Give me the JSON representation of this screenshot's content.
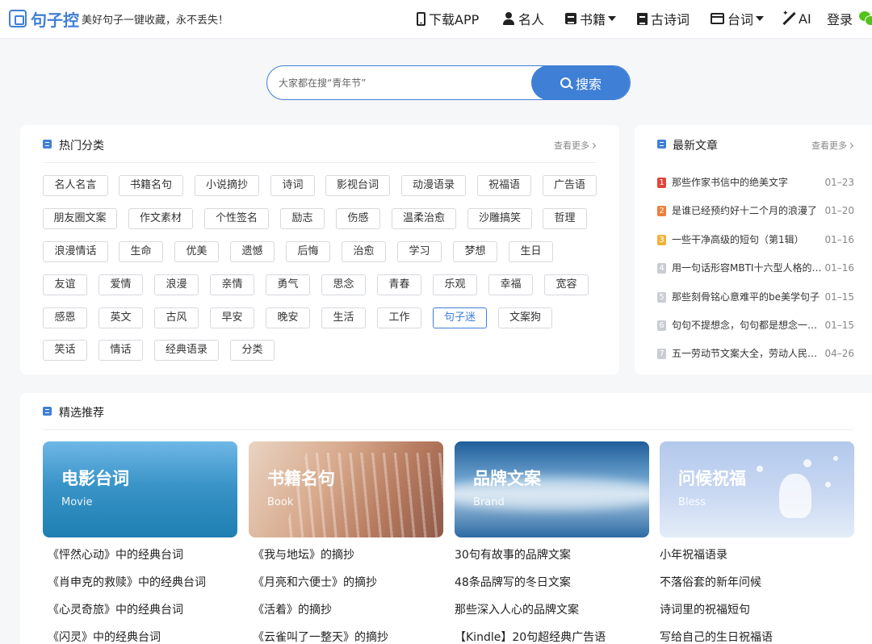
{
  "header": {
    "logo_text": "句子控",
    "slogan": "美好句子一键收藏，永不丢失！",
    "nav": {
      "download": "下载APP",
      "people": "名人",
      "books": "书籍",
      "poems": "古诗词",
      "lines": "台词",
      "ai": "AI",
      "login": "登录"
    }
  },
  "search": {
    "placeholder": "大家都在搜“青年节”",
    "button_label": "搜索"
  },
  "hot_categories": {
    "title": "热门分类",
    "more": "查看更多",
    "tags": [
      "名人名言",
      "书籍名句",
      "小说摘抄",
      "诗词",
      "影视台词",
      "动漫语录",
      "祝福语",
      "广告语",
      "朋友圈文案",
      "作文素材",
      "个性签名",
      "励志",
      "伤感",
      "温柔治愈",
      "沙雕搞笑",
      "哲理",
      "浪漫情话",
      "生命",
      "优美",
      "遗憾",
      "后悔",
      "治愈",
      "学习",
      "梦想",
      "生日",
      "友谊",
      "爱情",
      "浪漫",
      "亲情",
      "勇气",
      "思念",
      "青春",
      "乐观",
      "幸福",
      "宽容",
      "感恩",
      "英文",
      "古风",
      "早安",
      "晚安",
      "生活",
      "工作",
      "句子迷",
      "文案狗",
      "笑话",
      "情话",
      "经典语录",
      "分类"
    ],
    "active_tag": "句子迷"
  },
  "latest_articles": {
    "title": "最新文章",
    "more": "查看更多",
    "items": [
      {
        "rank": "1",
        "title": "那些作家书信中的绝美文字",
        "date": "01–23"
      },
      {
        "rank": "2",
        "title": "是谁已经预约好十二个月的浪漫了",
        "date": "01–20"
      },
      {
        "rank": "3",
        "title": "一些干净高级的短句（第1辑）",
        "date": "01–16"
      },
      {
        "rank": "4",
        "title": "用一句话形容MBTI十六型人格的特点",
        "date": "01–16"
      },
      {
        "rank": "5",
        "title": "那些刻骨铭心意难平的be美学句子",
        "date": "01–15"
      },
      {
        "rank": "6",
        "title": "句句不提想念，句句都是想念一个人",
        "date": "01–15"
      },
      {
        "rank": "7",
        "title": "五一劳动节文案大全，劳动人民最光荣",
        "date": "04–26"
      }
    ],
    "rank_colors": [
      "#e0463c",
      "#ef7d3a",
      "#f0b43b",
      "#c9ccd2",
      "#c9ccd2",
      "#c9ccd2",
      "#c9ccd2"
    ]
  },
  "recommend": {
    "title": "精选推荐",
    "columns": [
      {
        "banner_title": "电影台词",
        "banner_sub": "Movie",
        "links": [
          "《怦然心动》中的经典台词",
          "《肖申克的救赎》中的经典台词",
          "《心灵奇旅》中的经典台词",
          "《闪灵》中的经典台词"
        ]
      },
      {
        "banner_title": "书籍名句",
        "banner_sub": "Book",
        "links": [
          "《我与地坛》的摘抄",
          "《月亮和六便士》的摘抄",
          "《活着》的摘抄",
          "《云雀叫了一整天》的摘抄"
        ]
      },
      {
        "banner_title": "品牌文案",
        "banner_sub": "Brand",
        "links": [
          "30句有故事的品牌文案",
          "48条品牌写的冬日文案",
          "那些深入人心的品牌文案",
          "【Kindle】20句超经典广告语"
        ]
      },
      {
        "banner_title": "问候祝福",
        "banner_sub": "Bless",
        "links": [
          "小年祝福语录",
          "不落俗套的新年问候",
          "诗词里的祝福短句",
          "写给自己的生日祝福语"
        ]
      }
    ]
  },
  "colors": {
    "brand_blue": "#3f7fd6",
    "tag_border": "#d6d9de",
    "page_bg": "#f6f7f9"
  }
}
